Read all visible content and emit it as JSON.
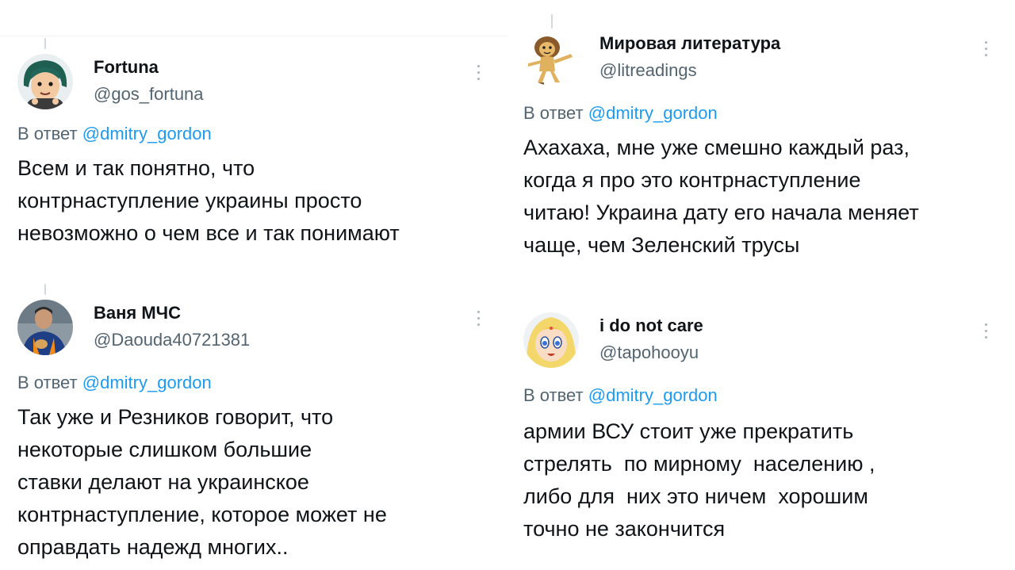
{
  "left": {
    "tweets": [
      {
        "name": "Fortuna",
        "handle": "@gos_fortuna",
        "reply_prefix": "В ответ",
        "reply_mention": "@dmitry_gordon",
        "text": "Всем и так понятно, что\nконтрнаступление украины просто\nневозможно о чем все и так понимают",
        "avatar_icon": "cartoon-girl-green-hair-avatar"
      },
      {
        "name": "Ваня МЧС",
        "handle": "@Daouda40721381",
        "reply_prefix": "В ответ",
        "reply_mention": "@dmitry_gordon",
        "text": "Так уже и Резников говорит, что\nнекоторые слишком большие\nставки делают на украинское\nконтрнаступление, которое может не\nоправдать надежд многих..",
        "avatar_icon": "rescuer-photo-avatar"
      }
    ]
  },
  "right": {
    "tweets": [
      {
        "name": "Мировая литература",
        "handle": "@litreadings",
        "reply_prefix": "В ответ",
        "reply_mention": "@dmitry_gordon",
        "text": "Ахахаха, мне уже смешно каждый раз,\nкогда я про это контрнаступление\nчитаю! Украина дату его начала меняет\nчаще, чем Зеленский трусы",
        "avatar_icon": "cartoon-lion-avatar"
      },
      {
        "name": "i do not care",
        "handle": "@tapohooyu",
        "reply_prefix": "В ответ",
        "reply_mention": "@dmitry_gordon",
        "text": "армии ВСУ стоит уже прекратить\nстрелять  по мирному  населению ,\nлибо для  них это ничем  хорошим\nточно не закончится",
        "avatar_icon": "anime-blonde-avatar"
      }
    ]
  },
  "colors": {
    "text": "#0f1419",
    "secondary": "#536471",
    "mention": "#1d9bf0",
    "divider": "#eff3f4"
  }
}
